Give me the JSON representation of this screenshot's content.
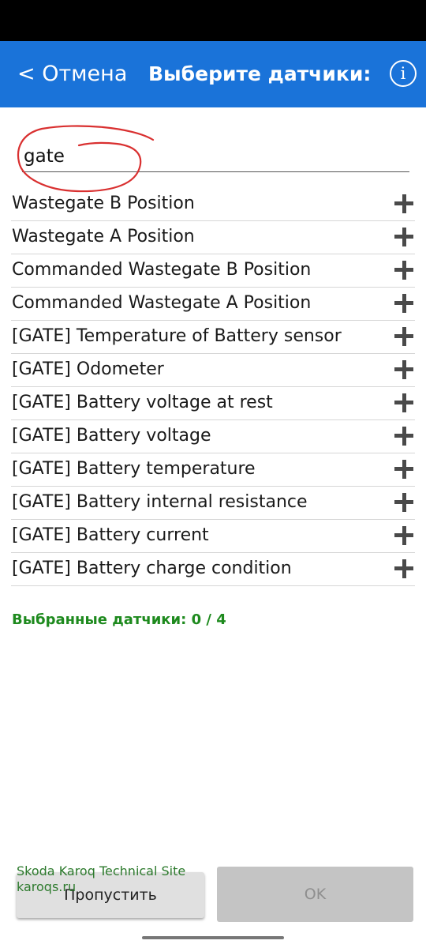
{
  "header": {
    "cancel_label": "< Отмена",
    "title": "Выберите датчики:",
    "info_icon": "info-icon",
    "accent_color": "#1a73d9"
  },
  "search": {
    "value": "gate"
  },
  "sensors": [
    {
      "label": "Wastegate B Position"
    },
    {
      "label": "Wastegate A Position"
    },
    {
      "label": "Commanded Wastegate B Position"
    },
    {
      "label": "Commanded Wastegate A Position"
    },
    {
      "label": "[GATE] Temperature of Battery sensor"
    },
    {
      "label": "[GATE] Odometer"
    },
    {
      "label": "[GATE] Battery voltage at rest"
    },
    {
      "label": "[GATE] Battery voltage"
    },
    {
      "label": "[GATE] Battery temperature"
    },
    {
      "label": "[GATE] Battery internal resistance"
    },
    {
      "label": "[GATE] Battery current"
    },
    {
      "label": "[GATE] Battery charge condition"
    }
  ],
  "add_icon": "plus-icon",
  "selected_text": "Выбранные датчики: 0 / 4",
  "selected_color": "#1e8a1e",
  "buttons": {
    "skip_label": "Пропустить",
    "ok_label": "OK"
  },
  "watermark": {
    "line1": "Skoda Karoq Technical Site",
    "line2": "karoqs.ru"
  },
  "annotation_color": "#d93030"
}
